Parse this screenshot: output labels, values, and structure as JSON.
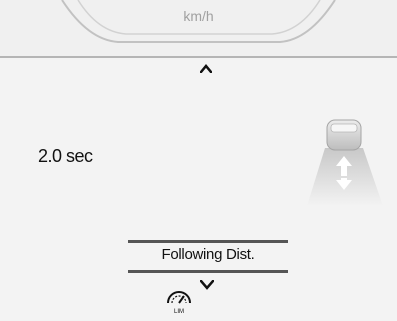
{
  "gauge": {
    "unit": "km/h"
  },
  "setting": {
    "value": "2.0 sec",
    "label": "Following Dist."
  },
  "icons": {
    "up": "chevron-up-icon",
    "down": "chevron-down-icon",
    "vehicle": "vehicle-distance-icon",
    "limiter": "speed-limiter-icon",
    "limiter_text": "LIM"
  }
}
